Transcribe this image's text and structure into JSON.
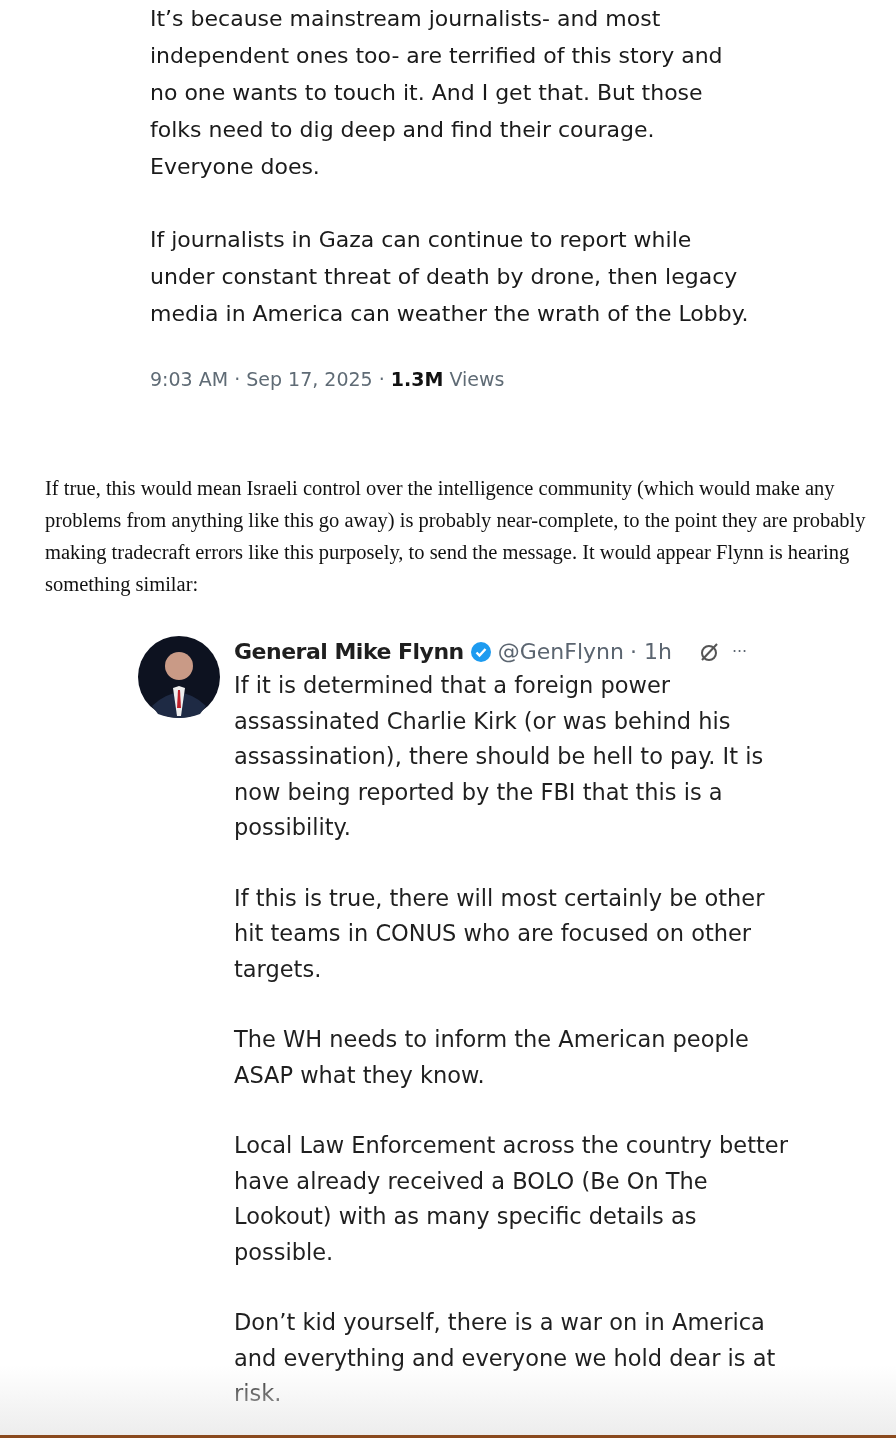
{
  "quoted_post": {
    "paragraphs": [
      "It’s because mainstream journalists- and most independent ones too- are terrified of this story and no one wants to touch it. And I get that. But those folks need to dig deep and find their courage. Everyone does.",
      "If journalists in Gaza can continue to report while under constant threat of death by drone, then legacy media in America can weather the wrath of the Lobby."
    ],
    "meta": "9:03 AM · Sep 17, 2025 · **1.3M** Views"
  },
  "article_paragraph": "If true, this would mean Israeli control over the intelligence community (which would make any problems from anything like this go away) is probably near-complete, to the point they are probably making tradecraft errors like this purposely, to send the message. It would appear Flynn is hearing something similar:",
  "embedded_post": {
    "name": "General Mike Flynn",
    "verified": true,
    "handle": "@GenFlynn",
    "time": "· 1h",
    "more": "···",
    "paragraphs": [
      "If it is determined that a foreign power assassinated Charlie Kirk (or was behind his assassination), there should be hell to pay. It is now being reported by the FBI that this is a possibility.",
      "If this is true, there will most certainly be other hit teams in CONUS who are focused on other targets.",
      "The WH needs to inform the American people ASAP what they know.",
      "Local Law Enforcement across the country better have already received a BOLO (Be On The Lookout) with as many specific details as possible.",
      "Don’t kid yourself, there is a war on in America and everything and everyone we hold dear is at risk."
    ]
  }
}
